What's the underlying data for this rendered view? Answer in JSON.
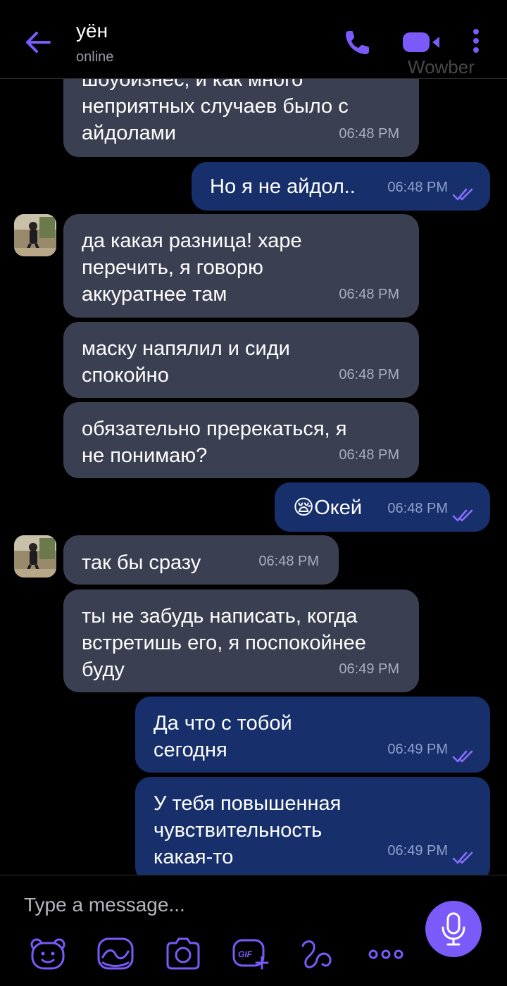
{
  "header": {
    "title": "уён",
    "status": "online",
    "watermark": "Wowber"
  },
  "colors": {
    "accent": "#7a5af8",
    "incoming_bubble": "#3b3f52",
    "outgoing_bubble": "#17306b"
  },
  "messages": [
    {
      "direction": "in",
      "text": "шоуоизнес, и как много\nнеприятных случаев было с\nайдолами",
      "time": "06:48 PM"
    },
    {
      "direction": "out",
      "text": "Но я не айдол..",
      "time": "06:48 PM",
      "read": true
    },
    {
      "direction": "in",
      "text": "да какая разница! харе\nперечить, я говорю\nаккуратнее там",
      "time": "06:48 PM",
      "avatar": true
    },
    {
      "direction": "in",
      "text": "маску напялил и сиди\nспокойно",
      "time": "06:48 PM"
    },
    {
      "direction": "in",
      "text": "обязательно пререкаться, я\nне понимаю?",
      "time": "06:48 PM"
    },
    {
      "direction": "out",
      "emoji": "😪",
      "text": "Окей",
      "time": "06:48 PM",
      "read": true
    },
    {
      "direction": "in",
      "text": "так бы сразу",
      "time": "06:48 PM",
      "avatar": true
    },
    {
      "direction": "in",
      "text": "ты не забудь написать, когда\nвстретишь его, я поспокойнее\nбуду",
      "time": "06:49 PM"
    },
    {
      "direction": "out",
      "text": "Да что с тобой\nсегодня",
      "time": "06:49 PM",
      "read": true
    },
    {
      "direction": "out",
      "text": "У тебя повышенная\nчувствительность\nкакая-то",
      "time": "06:49 PM",
      "read": true
    }
  ],
  "composer": {
    "placeholder": "Type a message...",
    "tools": [
      "sticker-icon",
      "doodle-icon",
      "camera-icon",
      "gif-icon",
      "extensions-icon",
      "more-options-icon"
    ],
    "gif_label": "GIF"
  }
}
